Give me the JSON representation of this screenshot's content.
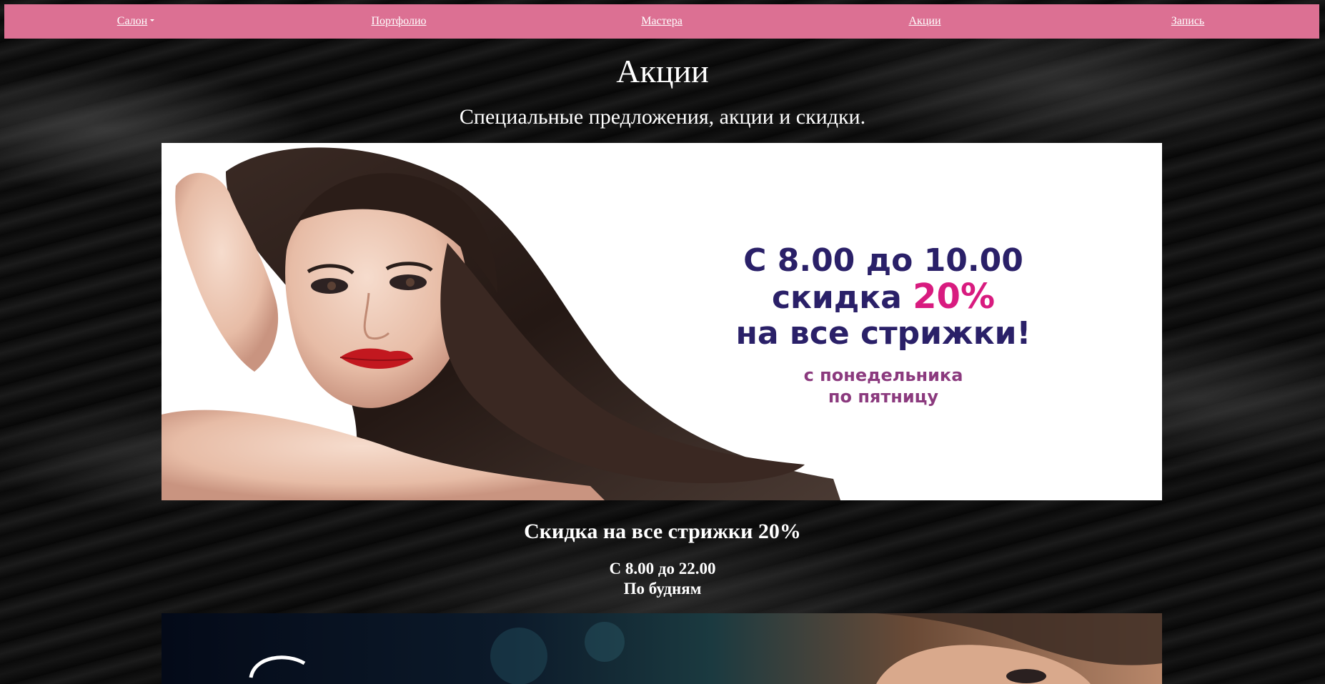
{
  "nav": {
    "items": [
      {
        "label": "Салон",
        "dropdown": true
      },
      {
        "label": "Портфолио"
      },
      {
        "label": "Мастера"
      },
      {
        "label": "Акции"
      },
      {
        "label": "Запись"
      }
    ],
    "color": "#dc7093"
  },
  "main": {
    "title": "Акции",
    "subtitle": "Специальные предложения, акции и скидки."
  },
  "banner1": {
    "line1": "С 8.00 до 10.00",
    "line2_prefix": "скидка ",
    "line2_accent": "20%",
    "line3": "на все стрижки!",
    "line4": "с понедельника",
    "line5": "по пятницу",
    "text_color": "#2a2068",
    "accent_color": "#d81b7f"
  },
  "promo": {
    "title": "Скидка на все стрижки 20%",
    "hours": "С 8.00 до 22.00",
    "days": "По будням"
  }
}
